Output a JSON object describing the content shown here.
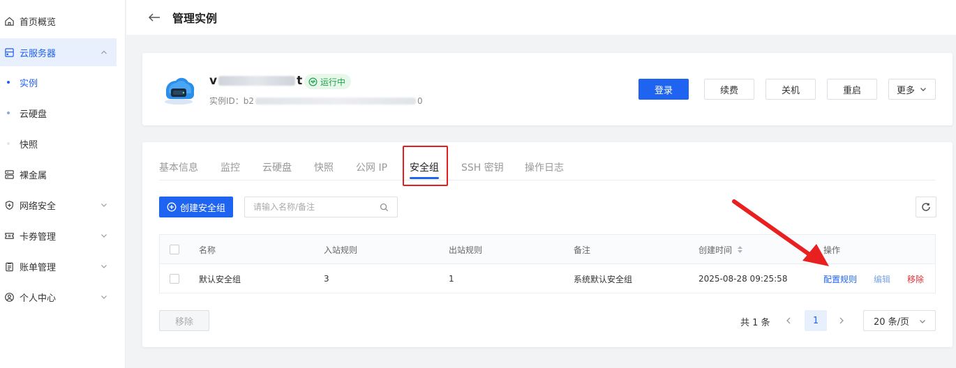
{
  "sidebar": {
    "items": [
      {
        "label": "首页概览",
        "icon": "home-icon"
      },
      {
        "label": "云服务器",
        "icon": "cloud-server-icon"
      },
      {
        "label": "实例"
      },
      {
        "label": "云硬盘"
      },
      {
        "label": "快照"
      },
      {
        "label": "裸金属",
        "icon": "server-rack-icon"
      },
      {
        "label": "网络安全",
        "icon": "shield-icon"
      },
      {
        "label": "卡券管理",
        "icon": "ticket-icon"
      },
      {
        "label": "账单管理",
        "icon": "bill-icon"
      },
      {
        "label": "个人中心",
        "icon": "user-icon"
      }
    ]
  },
  "header": {
    "title": "管理实例"
  },
  "instance": {
    "name_prefix": "v",
    "name_suffix": "t",
    "status": "运行中",
    "id_label": "实例ID：b2",
    "id_suffix": "0",
    "actions": {
      "login": "登录",
      "renew": "续费",
      "shutdown": "关机",
      "restart": "重启",
      "more": "更多"
    }
  },
  "tabs": [
    "基本信息",
    "监控",
    "云硬盘",
    "快照",
    "公网 IP",
    "安全组",
    "SSH 密钥",
    "操作日志"
  ],
  "toolbar": {
    "create": "创建安全组",
    "search_placeholder": "请输入名称/备注"
  },
  "table": {
    "headers": [
      "名称",
      "入站规则",
      "出站规则",
      "备注",
      "创建时间",
      "操作"
    ],
    "rows": [
      {
        "name": "默认安全组",
        "inbound": "3",
        "outbound": "1",
        "remark": "系统默认安全组",
        "created": "2025-08-28 09:25:58",
        "ops": {
          "config": "配置规则",
          "edit": "编辑",
          "remove": "移除"
        }
      }
    ]
  },
  "footer": {
    "remove": "移除",
    "total": "共 1 条",
    "page": "1",
    "page_size": "20 条/页"
  },
  "colors": {
    "accent": "#1e64f0",
    "danger": "#e03030",
    "success": "#1aa34a",
    "annotation": "#e82020"
  }
}
